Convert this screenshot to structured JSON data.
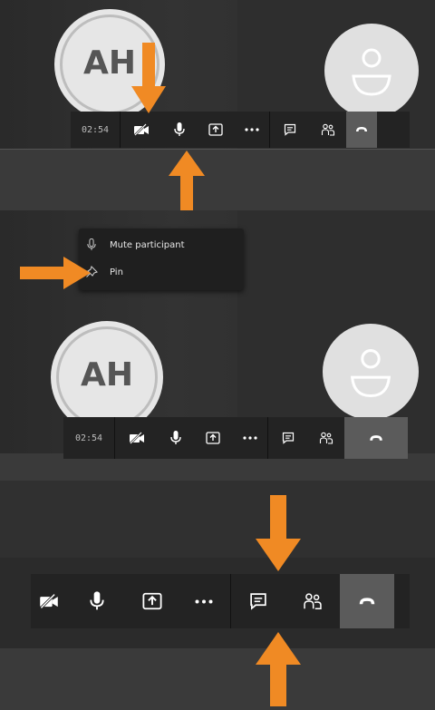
{
  "colors": {
    "arrow": "#f08a24",
    "toolbar": "#232323",
    "hangup": "#5b5b5b",
    "menu": "#1f1f1f"
  },
  "panel1": {
    "avatar_initials": "AH",
    "toolbar": {
      "timer": "02:54"
    }
  },
  "context_menu": {
    "items": [
      {
        "label": "Mute participant",
        "icon": "microphone-icon"
      },
      {
        "label": "Pin",
        "icon": "pin-icon"
      }
    ]
  },
  "panel2": {
    "avatar_initials": "AH",
    "toolbar": {
      "timer": "02:54"
    }
  },
  "icons": [
    "camera-off-icon",
    "microphone-icon",
    "share-screen-icon",
    "more-icon",
    "chat-icon",
    "participants-icon",
    "hang-up-icon"
  ]
}
